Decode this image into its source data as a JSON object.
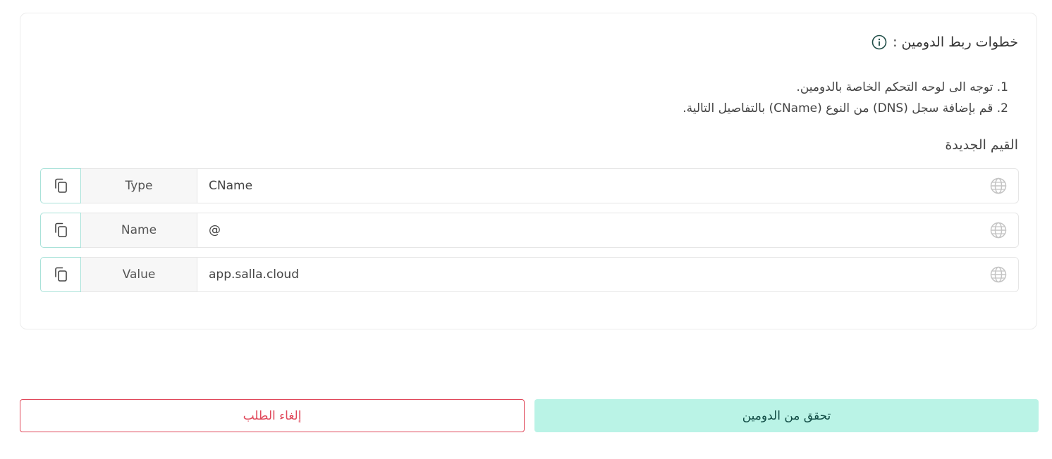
{
  "instructions": {
    "heading": "خطوات ربط الدومين :",
    "steps": [
      "1. توجه الى لوحه التحكم الخاصة بالدومين.",
      "2. قم بإضافة سجل (DNS) من النوع (CName) بالتفاصيل التالية."
    ]
  },
  "records": {
    "heading": "القيم الجديدة",
    "rows": [
      {
        "label": "Type",
        "value": "CName"
      },
      {
        "label": "Name",
        "value": "@"
      },
      {
        "label": "Value",
        "value": "app.salla.cloud"
      }
    ]
  },
  "actions": {
    "cancel_label": "إلغاء الطلب",
    "verify_label": "تحقق من الدومين"
  },
  "icons": {
    "info": "info-icon",
    "copy": "copy-icon",
    "globe": "globe-icon"
  },
  "colors": {
    "accent": "#baf3e6",
    "accent_text": "#114c45",
    "danger": "#e0485a",
    "copy_border": "#a9e2d9"
  }
}
